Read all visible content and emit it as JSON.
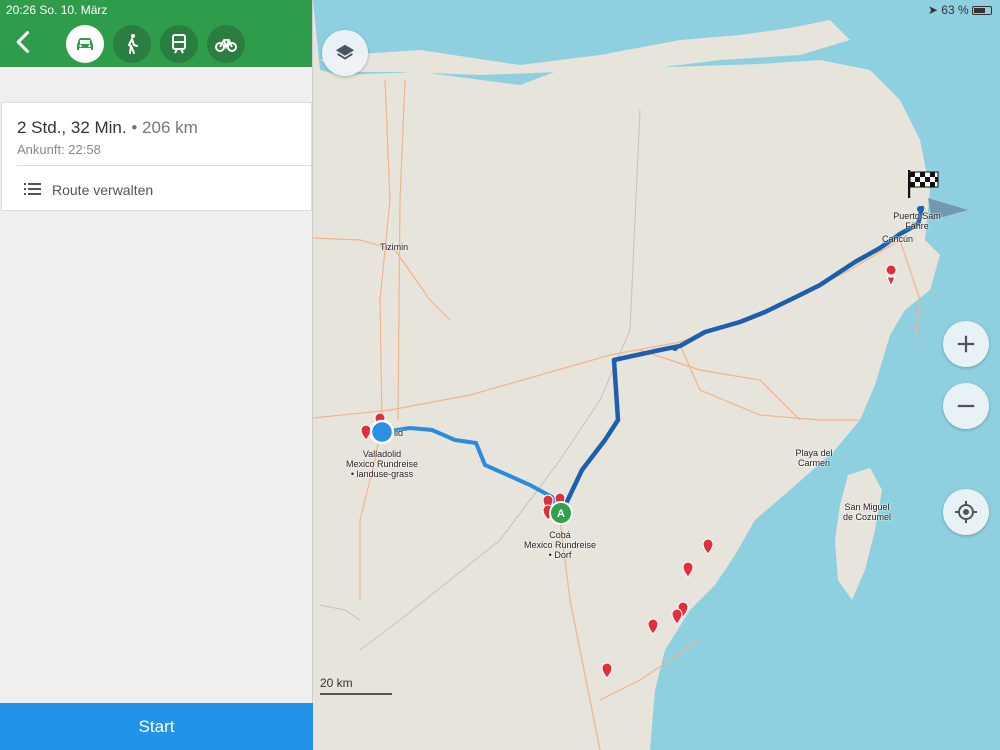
{
  "status": {
    "time_date": "20:26   So. 10. März",
    "battery": "63 %"
  },
  "modes": [
    "car-icon",
    "walk-icon",
    "train-icon",
    "bike-icon"
  ],
  "route": {
    "duration": "2 Std., 32 Min.",
    "separator": "•",
    "distance": "206 km",
    "arrival": "Ankunft: 22:58",
    "manage_label": "Route verwalten"
  },
  "start_label": "Start",
  "map": {
    "places": {
      "tizimin": "Tizimin",
      "valladolid": "Valladolid",
      "valladolid_clip": "lid",
      "valladolid_sub1": "Mexico Rundreise",
      "valladolid_sub2": "• landuse-grass",
      "coba": "Cobá",
      "coba_sub1": "Mexico Rundreise",
      "coba_sub2": "• Dorf",
      "playa1": "Playa del",
      "playa2": "Carmen",
      "cozumel1": "San Miguel",
      "cozumel2": "de Cozumel",
      "cancun": "Cancún",
      "puerto1": "Puerto Sam",
      "puerto2": "Fähre"
    },
    "start_marker": "A",
    "scale_label": "20 km",
    "colors": {
      "sea": "#8fd0e0",
      "land": "#e7e4dc",
      "route_dark": "#1c5fae",
      "route_light": "#2a8cdc",
      "pin": "#e0303e"
    }
  }
}
